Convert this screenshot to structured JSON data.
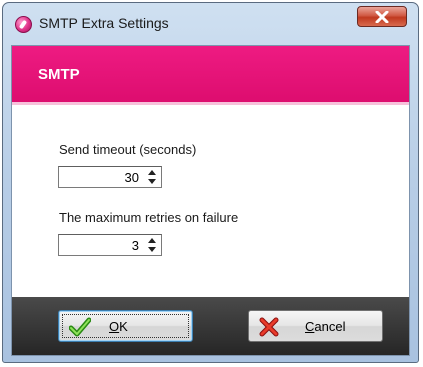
{
  "window": {
    "title": "SMTP Extra Settings",
    "icon": "smtp-app-icon"
  },
  "header": {
    "title": "SMTP"
  },
  "fields": {
    "send_timeout": {
      "label": "Send timeout (seconds)",
      "value": "30"
    },
    "max_retries": {
      "label": "The maximum retries on failure",
      "value": "3"
    }
  },
  "buttons": {
    "ok": {
      "mnemonic": "O",
      "rest": "K",
      "icon": "checkmark-icon"
    },
    "cancel": {
      "mnemonic": "C",
      "rest": "ancel",
      "icon": "red-x-icon"
    }
  },
  "colors": {
    "header_magenta": "#e5127a",
    "footer_dark": "#333333",
    "close_red": "#c8452f"
  }
}
